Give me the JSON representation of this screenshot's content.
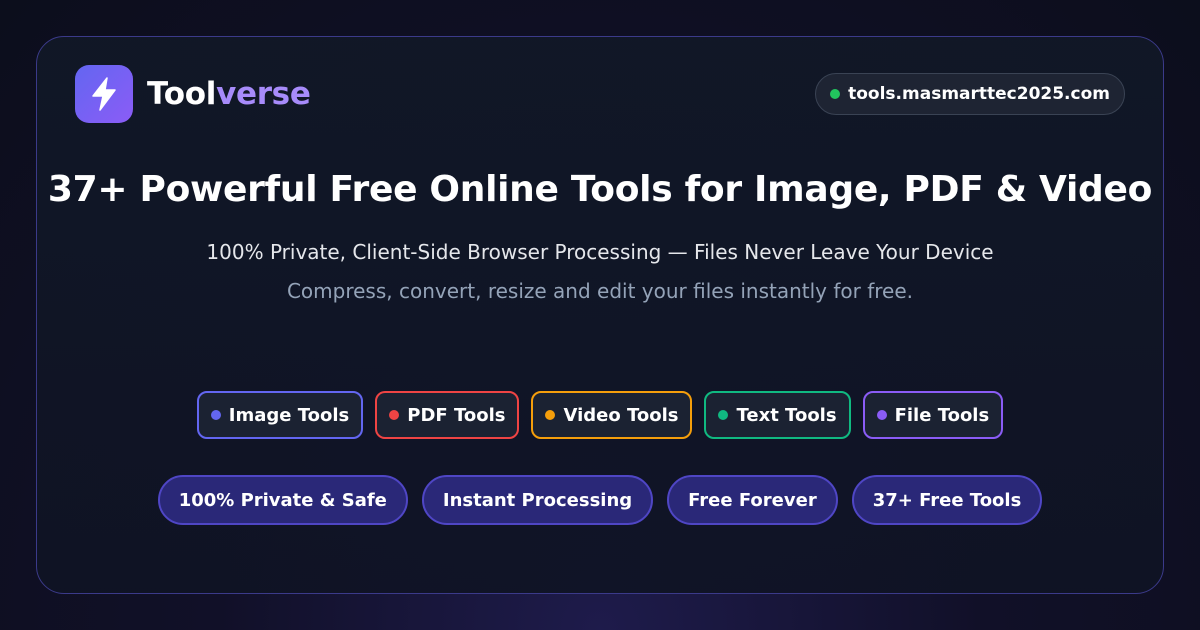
{
  "brand": {
    "name_part1": "Tool",
    "name_part2": "verse",
    "icon": "lightning-bolt-icon",
    "accent_color": "#a78bfa"
  },
  "url_badge": {
    "text": "tools.masmarttec2025.com",
    "status_color": "#22c55e"
  },
  "headline": "37+ Powerful Free Online Tools for Image, PDF & Video",
  "subheadline": "100% Private, Client-Side Browser Processing — Files Never Leave Your Device",
  "tagline": "Compress, convert, resize and edit your files instantly for free.",
  "categories": [
    {
      "label": "Image Tools",
      "color": "#6366f1"
    },
    {
      "label": "PDF Tools",
      "color": "#ef4444"
    },
    {
      "label": "Video Tools",
      "color": "#f59e0b"
    },
    {
      "label": "Text Tools",
      "color": "#10b981"
    },
    {
      "label": "File Tools",
      "color": "#8b5cf6"
    }
  ],
  "features": [
    {
      "label": "100% Private & Safe"
    },
    {
      "label": "Instant Processing"
    },
    {
      "label": "Free Forever"
    },
    {
      "label": "37+ Free Tools"
    }
  ]
}
